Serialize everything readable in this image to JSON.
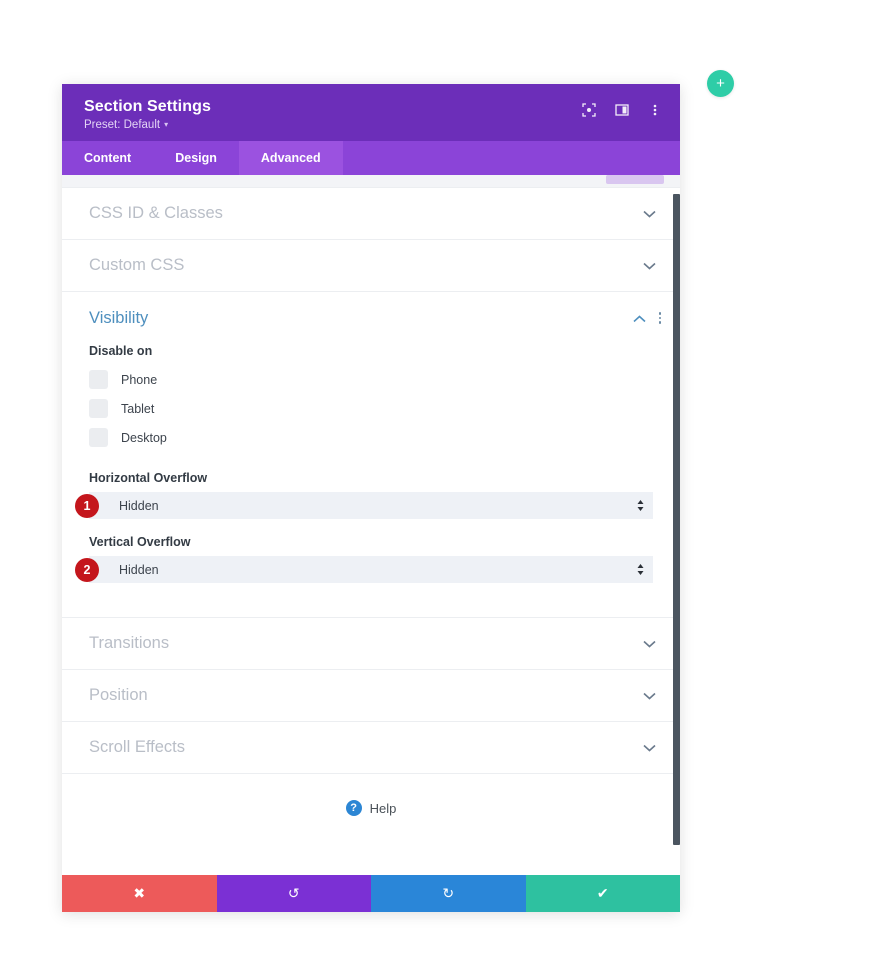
{
  "add_button": {
    "icon": "plus-icon",
    "label": "+",
    "color": "#2ecda7"
  },
  "header": {
    "title": "Section Settings",
    "preset_label": "Preset: Default",
    "preset_caret": "▾",
    "background": "#6c2eb9",
    "icons": [
      {
        "name": "fullscreen-icon"
      },
      {
        "name": "layout-panel-icon"
      },
      {
        "name": "kebab-menu-icon"
      }
    ]
  },
  "tabs": [
    {
      "label": "Content",
      "active": false
    },
    {
      "label": "Design",
      "active": false
    },
    {
      "label": "Advanced",
      "active": true
    }
  ],
  "tab_bar_color": "#8b44d8",
  "active_tab_color": "#9b52e0",
  "body": {
    "collapsed_top": [
      {
        "label": "CSS ID & Classes",
        "chevron": "⌄"
      },
      {
        "label": "Custom CSS",
        "chevron": "⌄"
      }
    ],
    "visibility": {
      "title": "Visibility",
      "title_color": "#4e8fbe",
      "chevron": "⌃",
      "kebab": "kebab-menu-icon",
      "disable_on_label": "Disable on",
      "disable_on_options": [
        {
          "label": "Phone",
          "checked": false
        },
        {
          "label": "Tablet",
          "checked": false
        },
        {
          "label": "Desktop",
          "checked": false
        }
      ],
      "horizontal_overflow": {
        "label": "Horizontal Overflow",
        "value": "Hidden",
        "badge": "1"
      },
      "vertical_overflow": {
        "label": "Vertical Overflow",
        "value": "Hidden",
        "badge": "2"
      },
      "badge_color": "#c4161c"
    },
    "collapsed_bottom": [
      {
        "label": "Transitions",
        "chevron": "⌄"
      },
      {
        "label": "Position",
        "chevron": "⌄"
      },
      {
        "label": "Scroll Effects",
        "chevron": "⌄"
      }
    ],
    "help": {
      "icon": "question-mark-icon",
      "label": "Help"
    }
  },
  "footer": {
    "buttons": [
      {
        "name": "cancel",
        "glyph": "✖",
        "color": "#ed5a5a"
      },
      {
        "name": "undo",
        "glyph": "↺",
        "color": "#7b30d4"
      },
      {
        "name": "redo",
        "glyph": "↻",
        "color": "#2a86d8"
      },
      {
        "name": "save",
        "glyph": "✔",
        "color": "#2ec1a0"
      }
    ]
  }
}
